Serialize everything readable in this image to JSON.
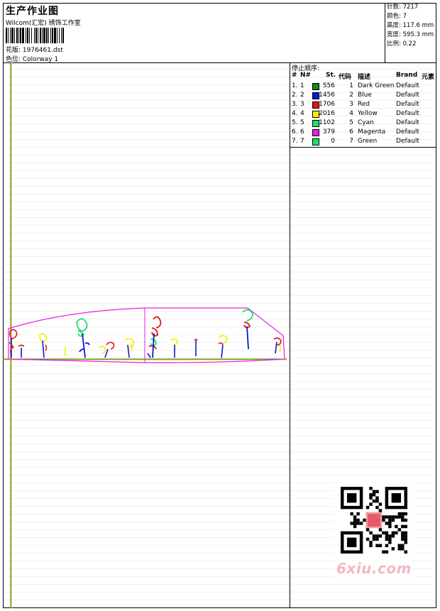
{
  "header": {
    "title": "生产作业图",
    "company": "Wilcom(汇宏) 绣饰工作室",
    "design_label": "花版: 1976461.dst",
    "colorway_label": "色位: Colorway 1"
  },
  "specs": {
    "stitches": "针数: 7217",
    "colors": "颜色: 7",
    "height": "高度: 117.6 mm",
    "width": "宽度: 595.3 mm",
    "scale": "比例: 0.22"
  },
  "sequence": {
    "title": "停止顺序:",
    "columns": {
      "num": "#",
      "no": "N#",
      "st": "St.",
      "code": "代码",
      "desc": "描述",
      "brand": "Brand",
      "elem": "元素"
    },
    "rows": [
      {
        "num": "1.",
        "no": "1",
        "color": "#138a13",
        "st": "556",
        "code": "1",
        "desc": "Dark Green",
        "brand": "Default"
      },
      {
        "num": "2.",
        "no": "2",
        "color": "#0d18d6",
        "st": "1456",
        "code": "2",
        "desc": "Blue",
        "brand": "Default"
      },
      {
        "num": "3.",
        "no": "3",
        "color": "#e81414",
        "st": "1706",
        "code": "3",
        "desc": "Red",
        "brand": "Default"
      },
      {
        "num": "4.",
        "no": "4",
        "color": "#f3f000",
        "st": "2016",
        "code": "4",
        "desc": "Yellow",
        "brand": "Default"
      },
      {
        "num": "5.",
        "no": "5",
        "color": "#20e06a",
        "st": "1102",
        "code": "5",
        "desc": "Cyan",
        "brand": "Default"
      },
      {
        "num": "6.",
        "no": "6",
        "color": "#e81ee0",
        "st": "379",
        "code": "6",
        "desc": "Magenta",
        "brand": "Default"
      },
      {
        "num": "7.",
        "no": "7",
        "color": "#20e06a",
        "st": "0",
        "code": "7",
        "desc": "Green",
        "brand": "Default"
      }
    ]
  },
  "watermark": {
    "text": "6xiu.com"
  }
}
